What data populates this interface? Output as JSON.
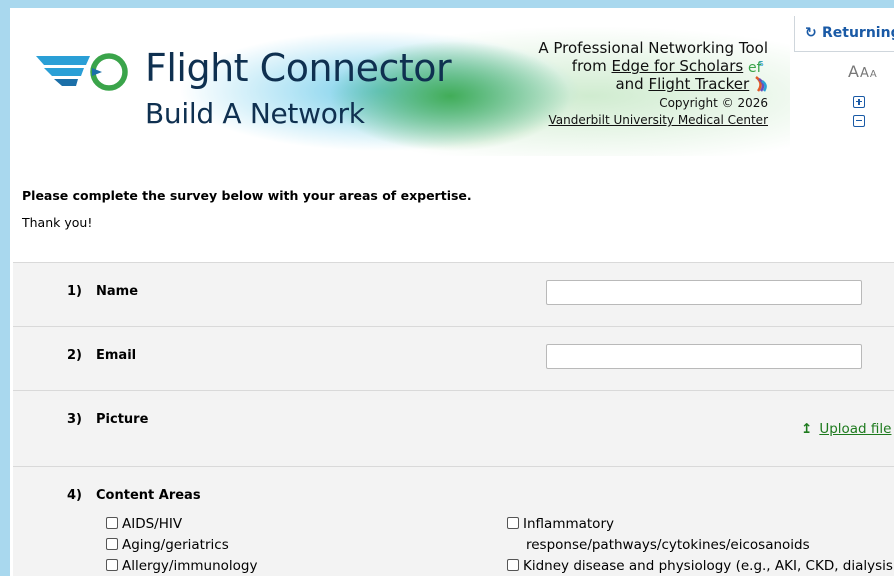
{
  "header": {
    "title": "Flight Connector",
    "subtitle": "Build A Network",
    "tool_line1": "A Professional Networking Tool",
    "tool_from": "from",
    "edge_link": "Edge for Scholars",
    "tool_and": "and",
    "flight_tracker_link": "Flight Tracker",
    "copyright": "Copyright © 2026",
    "vumc_link": "Vanderbilt University Medical Center"
  },
  "topright": {
    "returning_label": "Returning",
    "font_sizes": [
      "A",
      "A",
      "A"
    ]
  },
  "instructions": {
    "main": "Please complete the survey below with your areas of expertise.",
    "thanks": "Thank you!"
  },
  "questions": [
    {
      "num": "1)",
      "label": "Name"
    },
    {
      "num": "2)",
      "label": "Email"
    },
    {
      "num": "3)",
      "label": "Picture",
      "upload_label": "Upload file"
    },
    {
      "num": "4)",
      "label": "Content Areas"
    }
  ],
  "content_areas": {
    "left": [
      "AIDS/HIV",
      "Aging/geriatrics",
      "Allergy/immunology"
    ],
    "right": [
      "Inflammatory",
      "response/pathways/cytokines/eicosanoids",
      "Kidney disease and physiology (e.g., AKI, CKD, dialysis,"
    ]
  },
  "colors": {
    "accent_blue": "#1a5aa6",
    "title_navy": "#0f3050",
    "upload_green": "#1d7a1d",
    "page_border": "#a9d8ee"
  }
}
